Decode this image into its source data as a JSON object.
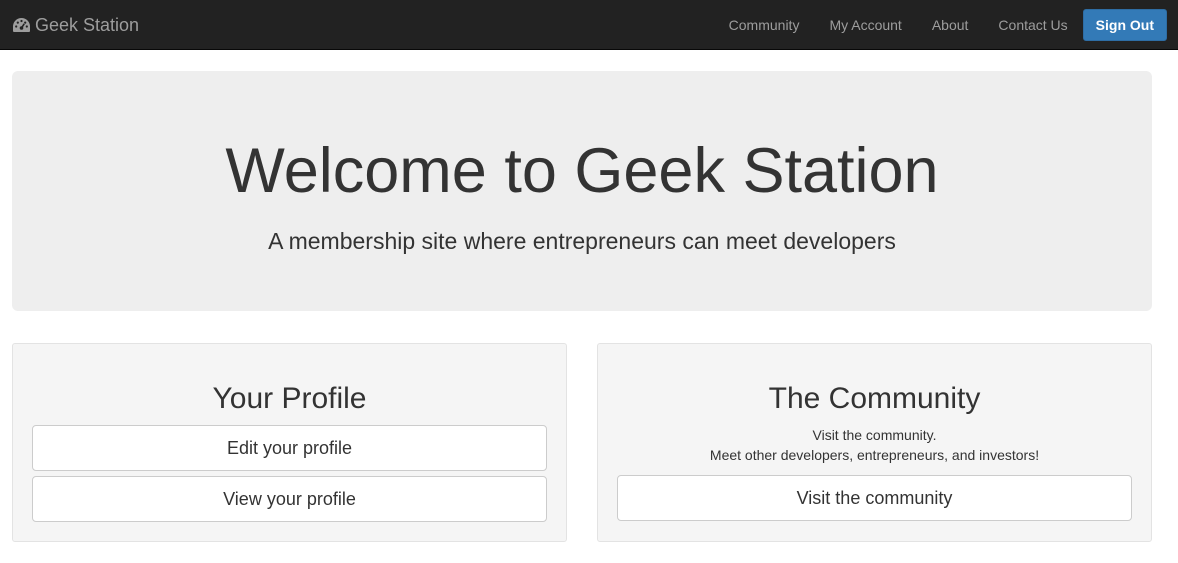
{
  "navbar": {
    "brand_icon": "dashboard-icon",
    "brand": "Geek Station",
    "links": [
      "Community",
      "My Account",
      "About",
      "Contact Us"
    ],
    "signout_label": "Sign Out",
    "accent_color": "#337ab7"
  },
  "hero": {
    "title": "Welcome to Geek Station",
    "subtitle": "A membership site where entrepreneurs can meet developers"
  },
  "profile_panel": {
    "title": "Your Profile",
    "buttons": [
      "Edit your profile",
      "View your profile"
    ]
  },
  "community_panel": {
    "title": "The Community",
    "description_line1": "Visit the community.",
    "description_line2": "Meet other developers, entrepreneurs, and investors!",
    "button": "Visit the community"
  }
}
